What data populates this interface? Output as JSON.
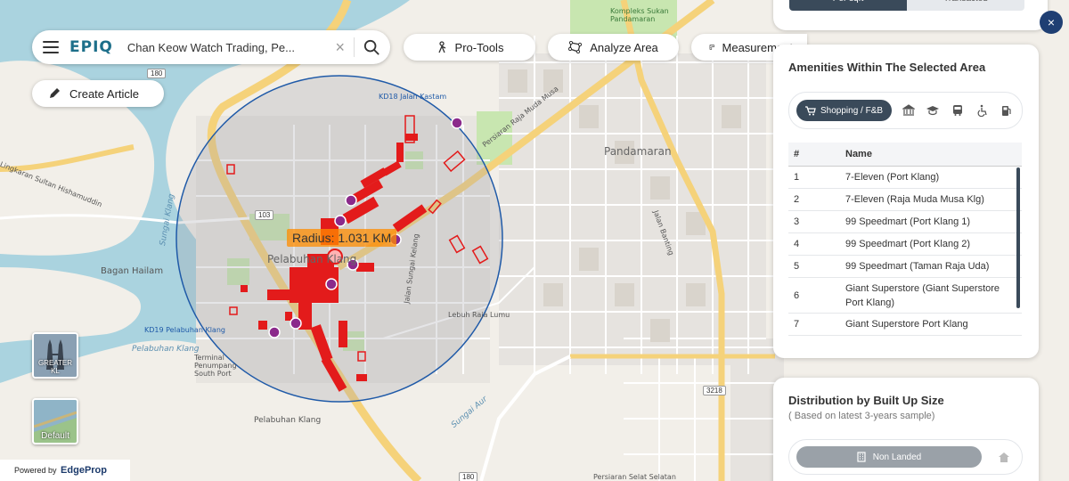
{
  "app": {
    "brand": "EPIQ",
    "menu_icon": "hamburger-menu-icon"
  },
  "search": {
    "value": "Chan Keow Watch Trading, Pe...",
    "clear_icon": "close-icon",
    "search_icon": "search-icon"
  },
  "toolbar": {
    "pro_tools": "Pro-Tools",
    "analyze_area": "Analyze Area",
    "measurement": "Measurement"
  },
  "create_article": "Create Article",
  "map": {
    "radius_label": "Radius: 1.031 KM",
    "labels": {
      "kd18": "KD18 Jalan Kastam",
      "kd19": "KD19 Pelabuhan Klang",
      "pelabuhan_klang": "Pelabuhan Klang",
      "pandamaran": "Pandamaran",
      "bagan_hailam": "Bagan Hailam",
      "sungai_klang": "Sungai Klang",
      "persiaran_raja_muda_musa": "Persiaran Raja Muda Musa",
      "jalan_sungai_kelang": "Jalan Sungai Kelang",
      "lebuh_raja_lumu": "Lebuh Raja Lumu",
      "jalan_banting": "Jalan Banting",
      "lingkaran_sultan": "Lingkaran Sultan Hishamuddin",
      "pelabuhan_klang_lower": "Pelabuhan Klang",
      "terminal": "Terminal Penumpang South Port",
      "pelabuhan_klang_water": "Pelabuhan Klang",
      "persiaran_selat_selatan": "Persiaran Selat Selatan",
      "sungai_aur": "Sungai Aur",
      "kompleks": "Kompleks Sukan Pandamaran"
    },
    "road_shields": [
      "180",
      "103",
      "180",
      "3218"
    ],
    "map_colors": {
      "water": "#aad3df",
      "land": "#f2efe9",
      "highway": "#f5d27a",
      "circle_stroke": "#1f5aa8",
      "amenity": "#e31b1b",
      "poi": "#8b2a8b"
    }
  },
  "layers": {
    "greater_kl": "GREATER KL",
    "default": "Default"
  },
  "powered_by": {
    "prefix": "Powered by",
    "brand": "EdgeProp"
  },
  "price_toggle": {
    "active": "Per sqft",
    "inactive": "Transacted"
  },
  "amenities": {
    "title": "Amenities Within The Selected Area",
    "active_category": "Shopping / F&B",
    "category_icons": [
      "cart-icon",
      "bank-icon",
      "school-icon",
      "bus-icon",
      "wheelchair-icon",
      "fuel-icon"
    ],
    "columns": [
      "#",
      "Name"
    ],
    "rows": [
      {
        "num": "1",
        "name": "7-Eleven (Port Klang)"
      },
      {
        "num": "2",
        "name": "7-Eleven (Raja Muda Musa Klg)"
      },
      {
        "num": "3",
        "name": "99 Speedmart (Port Klang 1)"
      },
      {
        "num": "4",
        "name": "99 Speedmart (Port Klang 2)"
      },
      {
        "num": "5",
        "name": "99 Speedmart (Taman Raja Uda)"
      },
      {
        "num": "6",
        "name": "Giant Superstore (Giant Superstore Port Klang)"
      },
      {
        "num": "7",
        "name": "Giant Superstore Port Klang"
      }
    ]
  },
  "distribution": {
    "title": "Distribution by Built Up Size",
    "subtitle": "( Based on latest 3-years sample)",
    "active_type": "Non Landed",
    "inactive_type_icon": "house-icon"
  }
}
